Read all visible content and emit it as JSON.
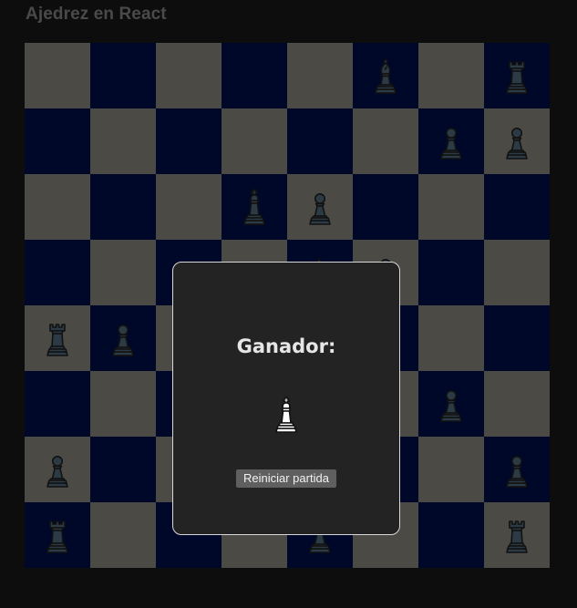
{
  "header": {
    "title": "Ajedrez en React"
  },
  "colors": {
    "light_square": "#4b4a45",
    "dark_square": "#00082a",
    "dark_piece_fill": "#2b3a44",
    "white_piece_fill": "#ffffff",
    "piece_outline": "#111111"
  },
  "board": {
    "rows": [
      [
        null,
        null,
        null,
        null,
        null,
        {
          "type": "bishop",
          "color": "black"
        },
        null,
        {
          "type": "rook",
          "color": "black"
        }
      ],
      [
        null,
        null,
        null,
        null,
        null,
        null,
        {
          "type": "pawn",
          "color": "black"
        },
        {
          "type": "pawn",
          "color": "black"
        }
      ],
      [
        null,
        null,
        null,
        {
          "type": "king",
          "color": "black"
        },
        {
          "type": "pawn",
          "color": "black"
        },
        null,
        null,
        null
      ],
      [
        null,
        null,
        null,
        null,
        {
          "type": "knight",
          "color": "black"
        },
        {
          "type": "pawn",
          "color": "black"
        },
        null,
        null
      ],
      [
        {
          "type": "rook",
          "color": "black"
        },
        {
          "type": "pawn",
          "color": "black"
        },
        null,
        null,
        null,
        null,
        null,
        null
      ],
      [
        null,
        null,
        null,
        null,
        null,
        null,
        {
          "type": "pawn",
          "color": "black"
        },
        null
      ],
      [
        {
          "type": "pawn",
          "color": "black"
        },
        null,
        null,
        null,
        null,
        null,
        null,
        {
          "type": "pawn",
          "color": "black"
        }
      ],
      [
        {
          "type": "rook",
          "color": "black"
        },
        null,
        null,
        null,
        {
          "type": "pawn",
          "color": "black"
        },
        null,
        null,
        {
          "type": "rook",
          "color": "black"
        }
      ]
    ]
  },
  "modal": {
    "title": "Ganador:",
    "winner_piece": {
      "type": "king",
      "color": "white"
    },
    "restart_label": "Reiniciar partida"
  }
}
